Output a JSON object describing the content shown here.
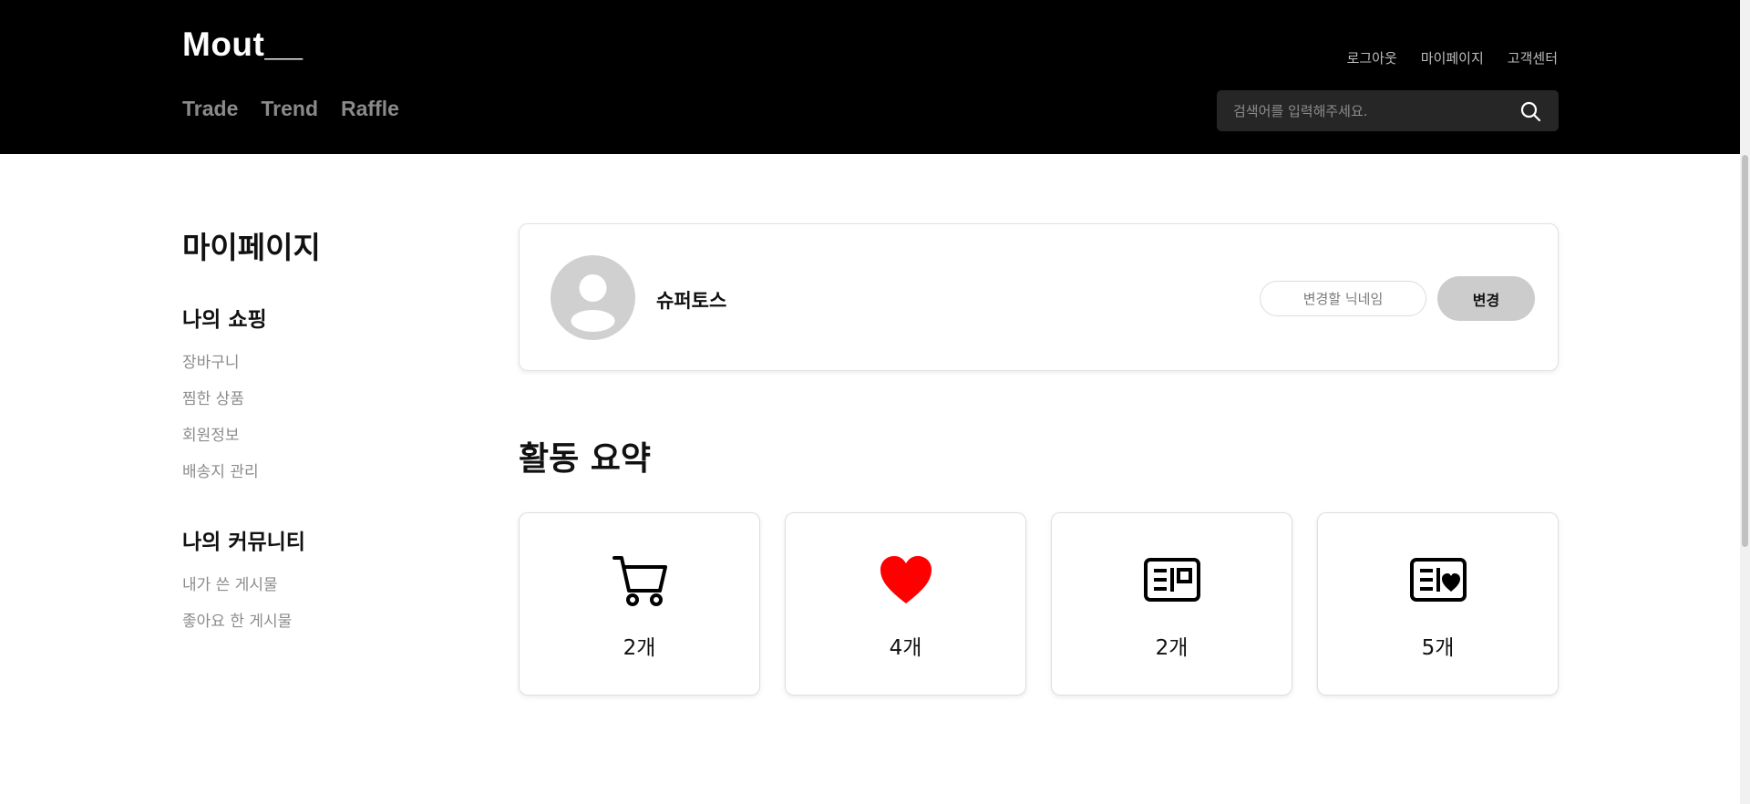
{
  "header": {
    "logo": "Mout__",
    "nav": [
      "Trade",
      "Trend",
      "Raffle"
    ],
    "util": [
      "로그아웃",
      "마이페이지",
      "고객센터"
    ],
    "search": {
      "placeholder": "검색어를 입력해주세요.",
      "value": ""
    }
  },
  "sidebar": {
    "title": "마이페이지",
    "shopping": {
      "heading": "나의 쇼핑",
      "items": [
        "장바구니",
        "찜한 상품",
        "회원정보",
        "배송지 관리"
      ]
    },
    "community": {
      "heading": "나의 커뮤니티",
      "items": [
        "내가 쓴 게시물",
        "좋아요 한 게시물"
      ]
    }
  },
  "profile": {
    "nickname": "슈퍼토스",
    "input_placeholder": "변경할 닉네임",
    "change_label": "변경"
  },
  "activity": {
    "title": "활동 요약",
    "cards": [
      {
        "icon": "cart-icon",
        "count": "2개"
      },
      {
        "icon": "heart-icon",
        "count": "4개",
        "color": "#ff0000"
      },
      {
        "icon": "post-card-icon",
        "count": "2개"
      },
      {
        "icon": "liked-post-icon",
        "count": "5개"
      }
    ]
  },
  "colors": {
    "header_bg": "#000000",
    "heart": "#ff0000",
    "button_bg": "#cccccc"
  }
}
